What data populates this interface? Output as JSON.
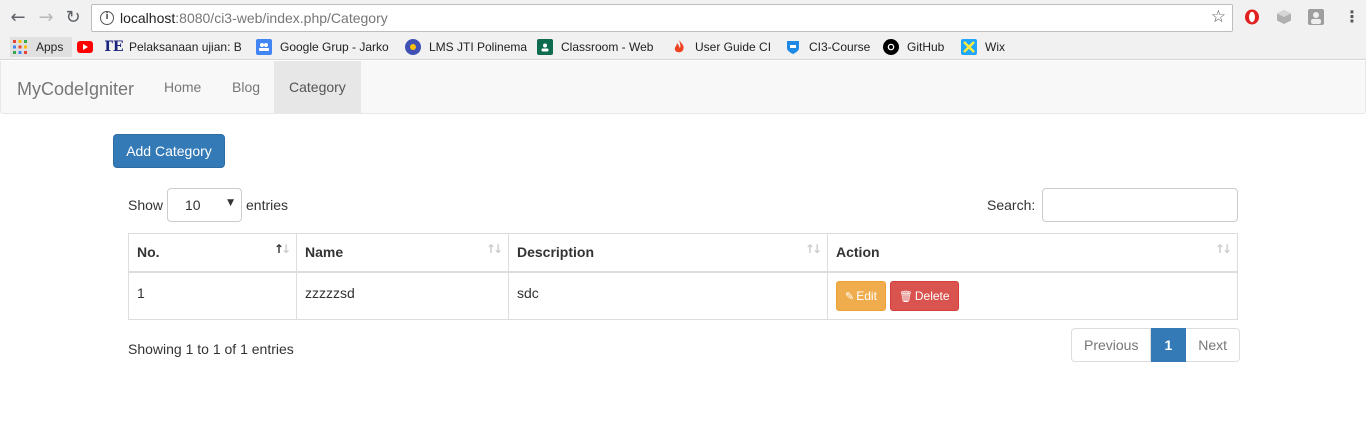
{
  "browser": {
    "url_host": "localhost",
    "url_rest": ":8080/ci3-web/index.php/Category",
    "back_icon": "←",
    "forward_icon": "→",
    "reload_icon": "↻",
    "bookmarks": [
      {
        "label": "Apps",
        "icon": "apps-grid",
        "color": "#4285f4"
      },
      {
        "label": "",
        "icon": "youtube",
        "color": "#ff0000"
      },
      {
        "label": "Pelaksanaan ujian: Ba",
        "icon": "te-logo",
        "color": "#1a237e"
      },
      {
        "label": "Google Grup - Jarko",
        "icon": "google-groups",
        "color": "#4285f4"
      },
      {
        "label": "LMS JTI Polinema",
        "icon": "polinema-seal",
        "color": "#3f51b5"
      },
      {
        "label": "Classroom - Web",
        "icon": "classroom",
        "color": "#0f6b4f"
      },
      {
        "label": "User Guide CI",
        "icon": "codeigniter-flame",
        "color": "#ee4323"
      },
      {
        "label": "CI3-Course",
        "icon": "shield",
        "color": "#1e88e5"
      },
      {
        "label": "GitHub",
        "icon": "github",
        "color": "#000000"
      },
      {
        "label": "Wix",
        "icon": "wix",
        "color": "#1ea7fd"
      }
    ]
  },
  "navbar": {
    "brand": "MyCodeIgniter",
    "links": [
      "Home",
      "Blog",
      "Category"
    ],
    "active": "Category"
  },
  "content": {
    "add_button": "Add Category",
    "show_label": "Show",
    "length_value": "10",
    "entries_label": "entries",
    "search_label": "Search:",
    "search_value": "",
    "columns": [
      "No.",
      "Name",
      "Description",
      "Action"
    ],
    "rows": [
      {
        "no": "1",
        "name": "zzzzzsd",
        "description": "sdc",
        "edit": "Edit",
        "delete": "Delete"
      }
    ],
    "info": "Showing 1 to 1 of 1 entries",
    "pagination": {
      "previous": "Previous",
      "current": "1",
      "next": "Next"
    }
  },
  "colors": {
    "primary": "#337ab7",
    "warning": "#f0ad4e",
    "danger": "#d9534f",
    "navbar_bg": "#f8f8f8"
  }
}
